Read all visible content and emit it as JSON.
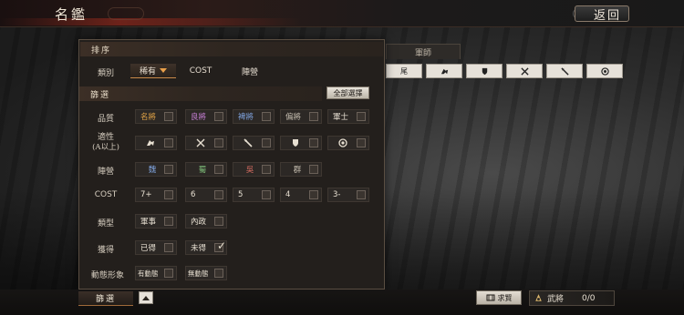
{
  "header": {
    "title": "名鑑",
    "back_label": "返回"
  },
  "background": {
    "tab_label": "軍師",
    "chip_first_label": "尾",
    "chip_icons": [
      "cavalry-icon",
      "shield-icon",
      "crossed-swords-icon",
      "spear-icon",
      "target-icon"
    ]
  },
  "sort": {
    "header": "排序",
    "row_label": "類別",
    "options": [
      {
        "label": "稀有",
        "active": true
      },
      {
        "label": "COST",
        "active": false
      },
      {
        "label": "陣營",
        "active": false
      }
    ]
  },
  "filter": {
    "header": "篩選",
    "select_all_label": "全部選擇",
    "rows": [
      {
        "label": "品質",
        "options": [
          {
            "label": "名將",
            "color": "#e2a446",
            "checked": false
          },
          {
            "label": "良將",
            "color": "#c77fd6",
            "checked": false
          },
          {
            "label": "裨將",
            "color": "#7fa3de",
            "checked": false
          },
          {
            "label": "偏將",
            "color": "#c8c0b2",
            "checked": false
          },
          {
            "label": "軍士",
            "color": "#e8e0d2",
            "checked": false
          }
        ]
      },
      {
        "label": "適性",
        "sublabel": "(A以上)",
        "options": [
          {
            "icon": "cavalry-icon",
            "checked": false
          },
          {
            "icon": "crossed-swords-icon",
            "checked": false
          },
          {
            "icon": "spear-icon",
            "checked": false
          },
          {
            "icon": "shield-icon",
            "checked": false
          },
          {
            "icon": "target-icon",
            "checked": false
          }
        ]
      },
      {
        "label": "陣營",
        "options": [
          {
            "label": "魏",
            "color": "#7fa3de",
            "checked": false
          },
          {
            "label": "蜀",
            "color": "#7fbf7a",
            "checked": false
          },
          {
            "label": "吳",
            "color": "#d26a5f",
            "checked": false
          },
          {
            "label": "群",
            "color": "#c8c0b2",
            "checked": false
          }
        ]
      },
      {
        "label": "COST",
        "options": [
          {
            "label": "7+",
            "checked": false
          },
          {
            "label": "6",
            "checked": false
          },
          {
            "label": "5",
            "checked": false
          },
          {
            "label": "4",
            "checked": false
          },
          {
            "label": "3-",
            "checked": false
          }
        ]
      },
      {
        "label": "類型",
        "options": [
          {
            "label": "軍事",
            "checked": false
          },
          {
            "label": "內政",
            "checked": false
          }
        ]
      },
      {
        "label": "獲得",
        "options": [
          {
            "label": "已得",
            "checked": false
          },
          {
            "label": "未得",
            "checked": true
          }
        ]
      },
      {
        "label": "動態形象",
        "options": [
          {
            "label": "有動態",
            "checked": false
          },
          {
            "label": "無動態",
            "checked": false
          }
        ]
      }
    ]
  },
  "bottom": {
    "filter_label": "篩選",
    "camp_label": "求賢",
    "general_label": "武將",
    "general_count": "0/0"
  }
}
